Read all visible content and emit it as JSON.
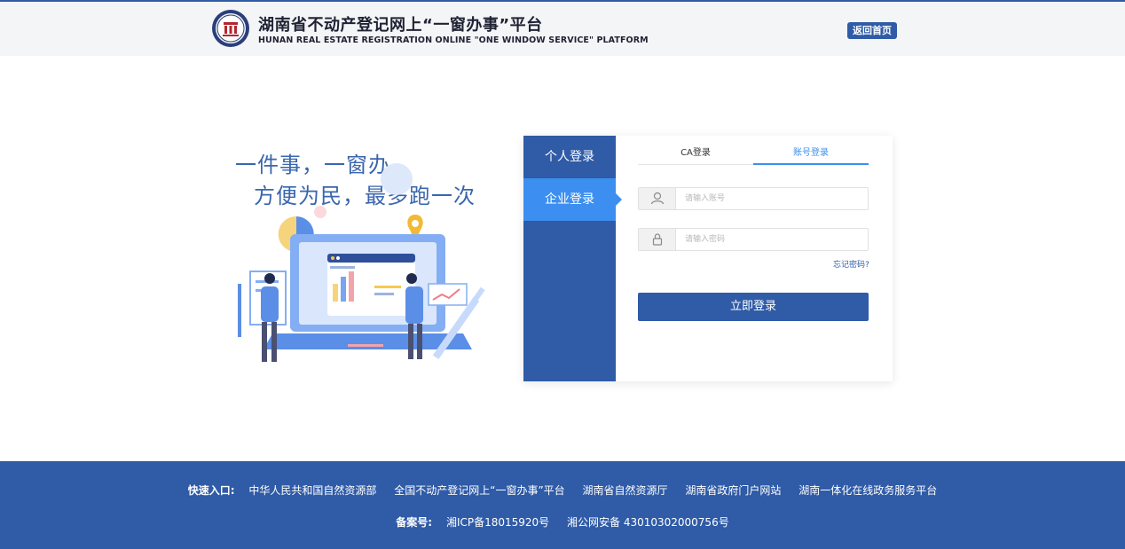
{
  "header": {
    "title_cn": "湖南省不动产登记网上“一窗办事”平台",
    "title_en": "HUNAN REAL ESTATE REGISTRATION ONLINE \"ONE WINDOW SERVICE\" PLATFORM",
    "home_button": "返回首页",
    "logo_icon": "emblem-icon"
  },
  "hero": {
    "slogan_line1": "一件事，一窗办",
    "slogan_line2": "方便为民，最多跑一次"
  },
  "login": {
    "side_tabs": [
      {
        "label": "个人登录",
        "active": false
      },
      {
        "label": "企业登录",
        "active": true
      }
    ],
    "tabs": [
      {
        "label": "CA登录",
        "active": false
      },
      {
        "label": "账号登录",
        "active": true
      }
    ],
    "account_placeholder": "请输入账号",
    "password_placeholder": "请输入密码",
    "forgot_password": "忘记密码?",
    "submit": "立即登录"
  },
  "footer": {
    "quick_label": "快速入口:",
    "links": [
      "中华人民共和国自然资源部",
      "全国不动产登记网上“一窗办事”平台",
      "湖南省自然资源厅",
      "湖南省政府门户网站",
      "湖南一体化在线政务服务平台"
    ],
    "record_label": "备案号:",
    "icp": "湘ICP备18015920号",
    "police_record": "湘公网安备 43010302000756号"
  },
  "colors": {
    "primary": "#2f5ba7",
    "accent": "#3c8ff0",
    "header_bg": "#f4f5f7"
  }
}
